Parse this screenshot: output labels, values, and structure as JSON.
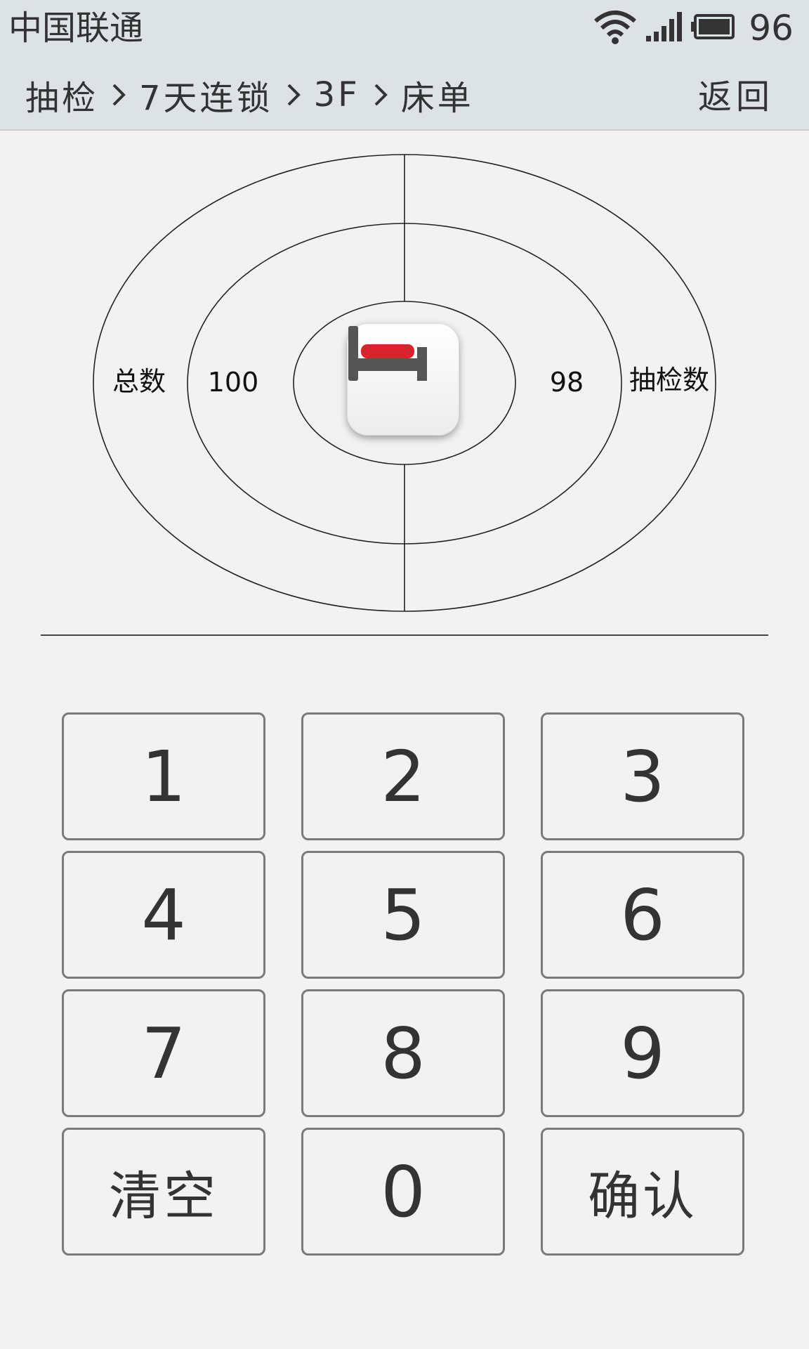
{
  "status_bar": {
    "carrier": "中国联通",
    "battery_level": "96",
    "icons": [
      "wifi-icon",
      "signal-icon",
      "battery-icon"
    ]
  },
  "header": {
    "breadcrumb": [
      "抽检",
      "7天连锁",
      "3F",
      "床单"
    ],
    "back_label": "返回"
  },
  "summary": {
    "total_label": "总数",
    "total_value": "100",
    "sampled_value": "98",
    "sampled_label": "抽检数",
    "center_icon": "bed-icon",
    "accent_color": "#d9232d"
  },
  "keypad": {
    "keys": [
      "1",
      "2",
      "3",
      "4",
      "5",
      "6",
      "7",
      "8",
      "9",
      "清空",
      "0",
      "确认"
    ]
  }
}
